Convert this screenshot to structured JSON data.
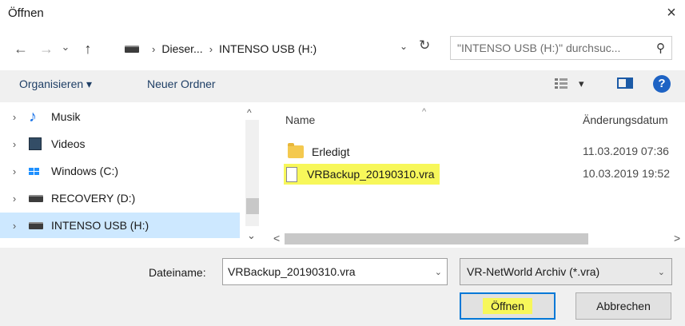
{
  "window": {
    "title": "Öffnen",
    "close_glyph": "×"
  },
  "nav": {
    "back_glyph": "←",
    "forward_glyph": "→",
    "recent_glyph": "⌄",
    "up_glyph": "↑",
    "breadcrumb": [
      {
        "label": "Dieser..."
      },
      {
        "label": "INTENSO USB (H:)"
      }
    ],
    "crumb_separator": "›",
    "dropdown_glyph": "⌄",
    "refresh_glyph": "↻",
    "search_placeholder": "\"INTENSO USB (H:)\" durchsuc...",
    "search_icon": "search-icon",
    "search_glyph": "⚲"
  },
  "toolbar": {
    "organize_label": "Organisieren ▾",
    "new_folder_label": "Neuer Ordner",
    "view_dropdown_glyph": "▾",
    "help_glyph": "?"
  },
  "tree": {
    "expand_glyph": "›",
    "items": [
      {
        "label": "Musik",
        "icon": "music-icon"
      },
      {
        "label": "Videos",
        "icon": "video-icon"
      },
      {
        "label": "Windows (C:)",
        "icon": "windows-drive-icon"
      },
      {
        "label": "RECOVERY (D:)",
        "icon": "drive-icon"
      },
      {
        "label": "INTENSO USB (H:)",
        "icon": "drive-icon",
        "selected": true
      }
    ],
    "scroll_up_glyph": "^",
    "scroll_down_glyph": "⌄"
  },
  "files": {
    "columns": {
      "name": "Name",
      "modified": "Änderungsdatum"
    },
    "sort_glyph": "^",
    "rows": [
      {
        "name": "Erledigt",
        "modified": "11.03.2019 07:36",
        "icon": "folder-icon",
        "highlighted": false
      },
      {
        "name": "VRBackup_20190310.vra",
        "modified": "10.03.2019 19:52",
        "icon": "file-icon",
        "highlighted": true
      }
    ],
    "hscroll_left_glyph": "<",
    "hscroll_right_glyph": ">"
  },
  "bottom": {
    "filename_label": "Dateiname:",
    "filename_value": "VRBackup_20190310.vra",
    "filename_dropdown_glyph": "⌄",
    "filetype_value": "VR-NetWorld Archiv (*.vra)",
    "filetype_dropdown_glyph": "⌄",
    "open_label": "Öffnen",
    "cancel_label": "Abbrechen"
  },
  "colors": {
    "highlight": "#f7f75a",
    "selection": "#cde8ff",
    "toolbar_bg": "#f0f0f0",
    "link": "#1f3f66",
    "accent": "#0078d7"
  }
}
